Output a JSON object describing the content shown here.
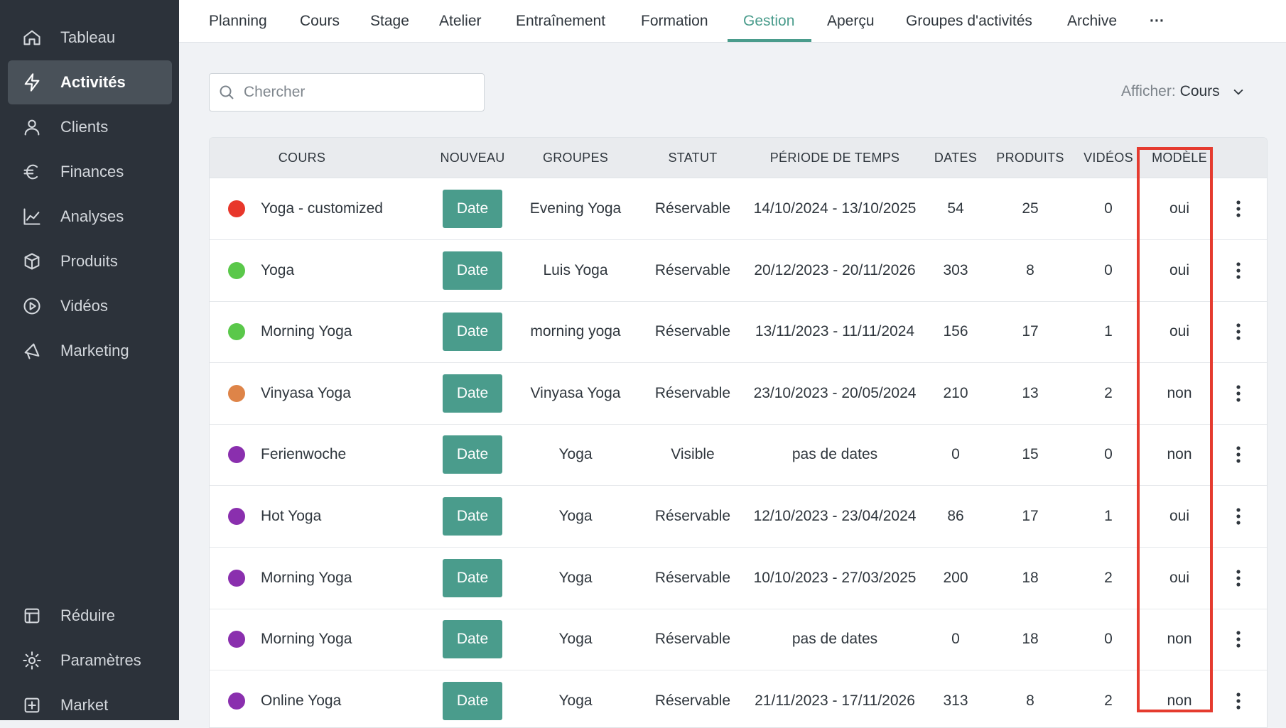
{
  "sidebar": {
    "items": [
      {
        "label": "Tableau",
        "icon": "home-icon"
      },
      {
        "label": "Activités",
        "icon": "bolt-icon",
        "active": true
      },
      {
        "label": "Clients",
        "icon": "user-icon"
      },
      {
        "label": "Finances",
        "icon": "euro-icon"
      },
      {
        "label": "Analyses",
        "icon": "chart-line-icon"
      },
      {
        "label": "Produits",
        "icon": "box-icon"
      },
      {
        "label": "Vidéos",
        "icon": "play-circle-icon"
      },
      {
        "label": "Marketing",
        "icon": "megaphone-icon"
      }
    ],
    "bottom_items": [
      {
        "label": "Réduire",
        "icon": "collapse-icon"
      },
      {
        "label": "Paramètres",
        "icon": "gear-icon"
      },
      {
        "label": "Market",
        "icon": "plus-square-icon"
      }
    ]
  },
  "tabs": [
    {
      "label": "Planning"
    },
    {
      "label": "Cours"
    },
    {
      "label": "Stage"
    },
    {
      "label": "Atelier"
    },
    {
      "label": "Entraînement"
    },
    {
      "label": "Formation"
    },
    {
      "label": "Gestion",
      "active": true
    },
    {
      "label": "Aperçu"
    },
    {
      "label": "Groupes d'activités"
    },
    {
      "label": "Archive"
    },
    {
      "label": "···"
    }
  ],
  "search": {
    "placeholder": "Chercher"
  },
  "filter": {
    "label": "Afficher:",
    "value": "Cours"
  },
  "table": {
    "headers": {
      "cours": "COURS",
      "nouveau": "NOUVEAU",
      "groupes": "GROUPES",
      "statut": "STATUT",
      "periode": "PÉRIODE DE TEMPS",
      "dates": "DATES",
      "produits": "PRODUITS",
      "videos": "VIDÉOS",
      "modele": "MODÈLE"
    },
    "rows": [
      {
        "color": "#e8372b",
        "name": "Yoga - customized",
        "button": "Date",
        "group": "Evening Yoga",
        "status": "Réservable",
        "period": "14/10/2024 - 13/10/2025",
        "dates": "54",
        "products": "25",
        "videos": "0",
        "model": "oui"
      },
      {
        "color": "#5ac84a",
        "name": "Yoga",
        "button": "Date",
        "group": "Luis Yoga",
        "status": "Réservable",
        "period": "20/12/2023 - 20/11/2026",
        "dates": "303",
        "products": "8",
        "videos": "0",
        "model": "oui"
      },
      {
        "color": "#5ac84a",
        "name": "Morning Yoga",
        "button": "Date",
        "group": "morning yoga",
        "status": "Réservable",
        "period": "13/11/2023 - 11/11/2024",
        "dates": "156",
        "products": "17",
        "videos": "1",
        "model": "oui"
      },
      {
        "color": "#de8448",
        "name": "Vinyasa Yoga",
        "button": "Date",
        "group": "Vinyasa Yoga",
        "status": "Réservable",
        "period": "23/10/2023 - 20/05/2024",
        "dates": "210",
        "products": "13",
        "videos": "2",
        "model": "non"
      },
      {
        "color": "#8a2fae",
        "name": "Ferienwoche",
        "button": "Date",
        "group": "Yoga",
        "status": "Visible",
        "period": "pas de dates",
        "dates": "0",
        "products": "15",
        "videos": "0",
        "model": "non"
      },
      {
        "color": "#8a2fae",
        "name": "Hot Yoga",
        "button": "Date",
        "group": "Yoga",
        "status": "Réservable",
        "period": "12/10/2023 - 23/04/2024",
        "dates": "86",
        "products": "17",
        "videos": "1",
        "model": "oui"
      },
      {
        "color": "#8a2fae",
        "name": "Morning Yoga",
        "button": "Date",
        "group": "Yoga",
        "status": "Réservable",
        "period": "10/10/2023 - 27/03/2025",
        "dates": "200",
        "products": "18",
        "videos": "2",
        "model": "oui"
      },
      {
        "color": "#8a2fae",
        "name": "Morning Yoga",
        "button": "Date",
        "group": "Yoga",
        "status": "Réservable",
        "period": "pas de dates",
        "dates": "0",
        "products": "18",
        "videos": "0",
        "model": "non"
      },
      {
        "color": "#8a2fae",
        "name": "Online Yoga",
        "button": "Date",
        "group": "Yoga",
        "status": "Réservable",
        "period": "21/11/2023 - 17/11/2026",
        "dates": "313",
        "products": "8",
        "videos": "2",
        "model": "non"
      }
    ]
  },
  "colors": {
    "accent": "#4a9c8c",
    "highlight": "#e53b2f",
    "sidebar_bg": "#2c323a"
  }
}
